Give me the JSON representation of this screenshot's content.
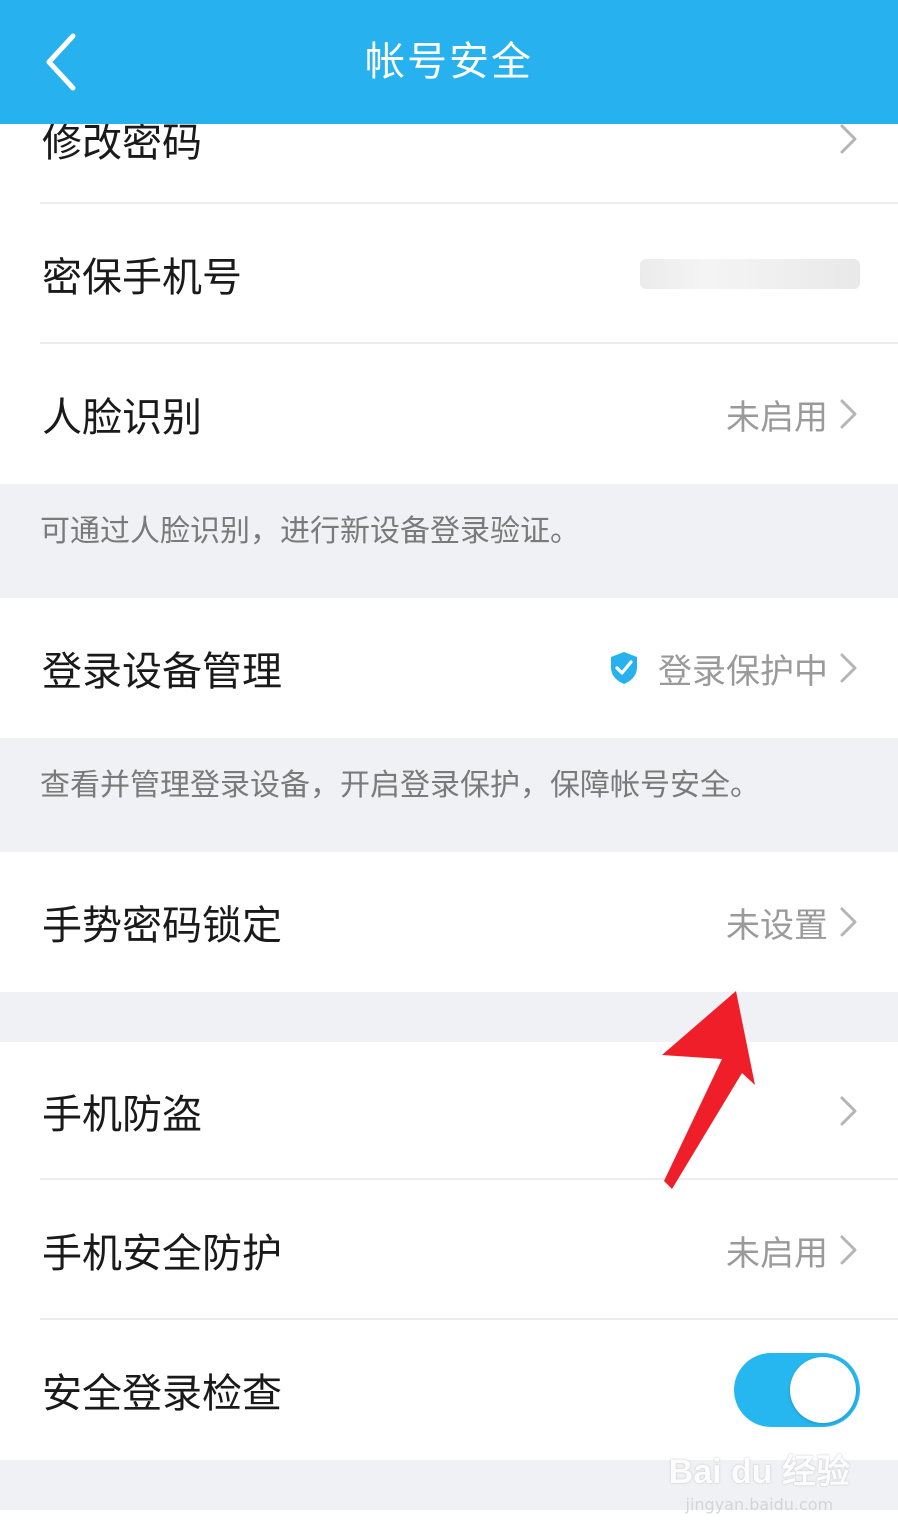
{
  "header": {
    "title": "帐号安全"
  },
  "rows": {
    "change_password": {
      "label": "修改密码"
    },
    "security_phone": {
      "label": "密保手机号"
    },
    "face_recognition": {
      "label": "人脸识别",
      "value": "未启用"
    },
    "device_management": {
      "label": "登录设备管理",
      "value": "登录保护中"
    },
    "gesture_lock": {
      "label": "手势密码锁定",
      "value": "未设置"
    },
    "anti_theft": {
      "label": "手机防盗"
    },
    "phone_protection": {
      "label": "手机安全防护",
      "value": "未启用"
    },
    "safe_login_check": {
      "label": "安全登录检查",
      "toggle_on": true
    }
  },
  "hints": {
    "face_hint": "可通过人脸识别，进行新设备登录验证。",
    "device_hint": "查看并管理登录设备，开启登录保护，保障帐号安全。"
  },
  "watermark": {
    "logo": "Bai du 经验",
    "url": "jingyan.baidu.com"
  },
  "colors": {
    "header_bg": "#27b1ee",
    "toggle_on": "#27b7f0",
    "shield": "#27b1ee",
    "annotation_arrow": "#f01e28"
  },
  "icons": {
    "back": "chevron-left-icon",
    "row_more": "chevron-right-icon",
    "protection": "shield-check-icon",
    "annotation": "red-arrow-icon"
  }
}
